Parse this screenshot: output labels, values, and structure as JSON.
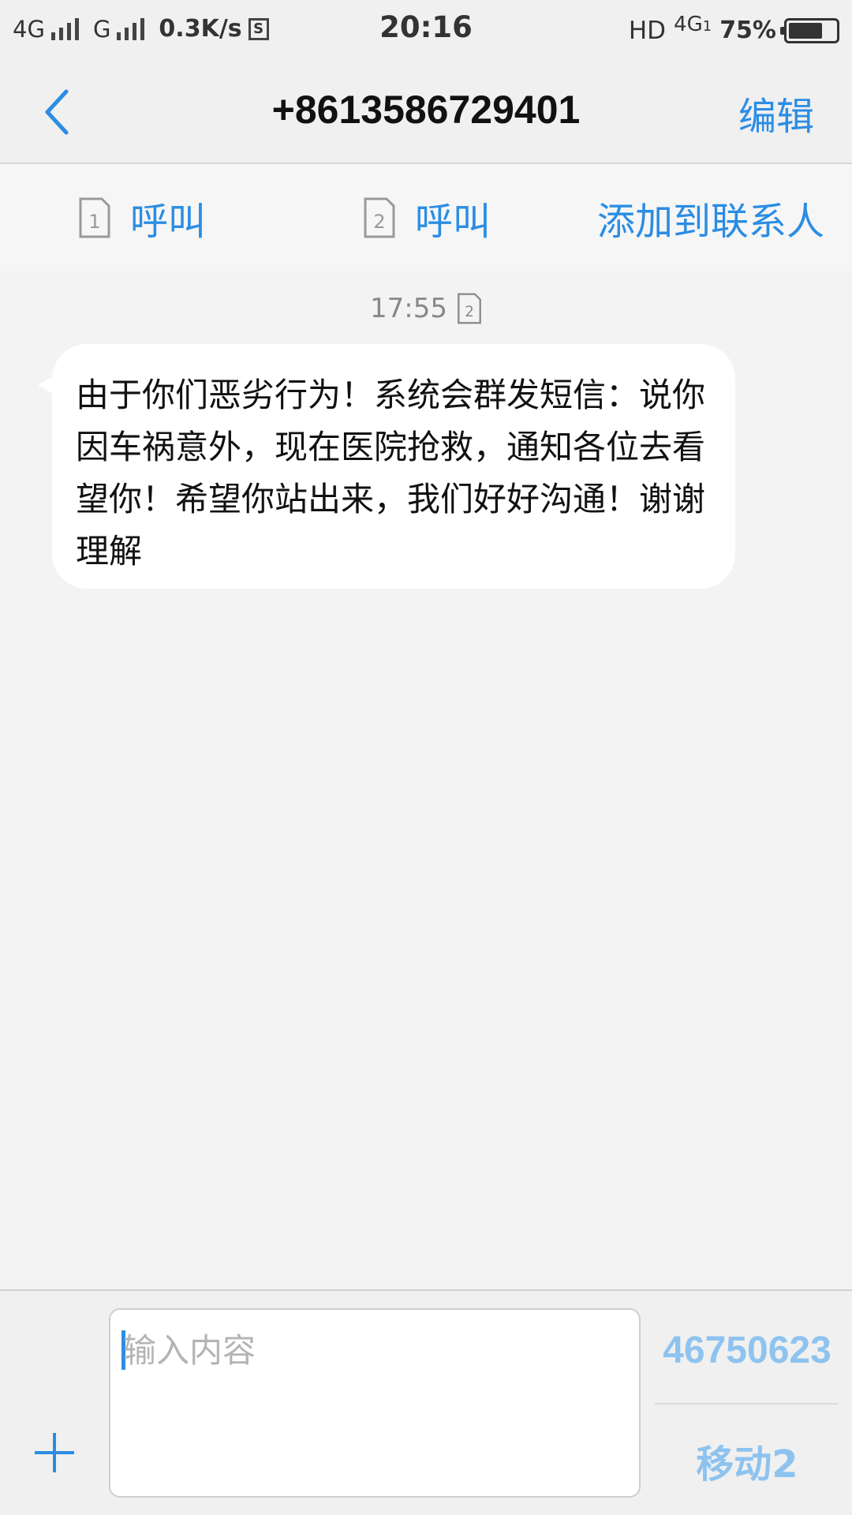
{
  "status_bar": {
    "network1": "4G",
    "network2": "G",
    "speed": "0.3K/s",
    "sim_icon_label": "S",
    "time": "20:16",
    "hd_label": "HD",
    "volte_label": "4G",
    "volte_sub": "1",
    "battery_percent": "75%",
    "battery_level": 0.75
  },
  "header": {
    "title": "+8613586729401",
    "edit_label": "编辑"
  },
  "actions": {
    "call1_label": "呼叫",
    "call1_sim": "1",
    "call2_label": "呼叫",
    "call2_sim": "2",
    "add_contact_label": "添加到联系人"
  },
  "conversation": {
    "timestamp": "17:55",
    "timestamp_sim": "2",
    "message": "由于你们恶劣行为！系统会群发短信：说你因车祸意外，现在医院抢救，通知各位去看望你！希望你站出来，我们好好沟通！谢谢理解"
  },
  "composer": {
    "placeholder": "输入内容",
    "send_number": "46750623",
    "send_carrier": "移动2"
  },
  "colors": {
    "accent": "#2b8de3",
    "accent_light": "#8ec3ef",
    "background": "#f3f3f3"
  }
}
